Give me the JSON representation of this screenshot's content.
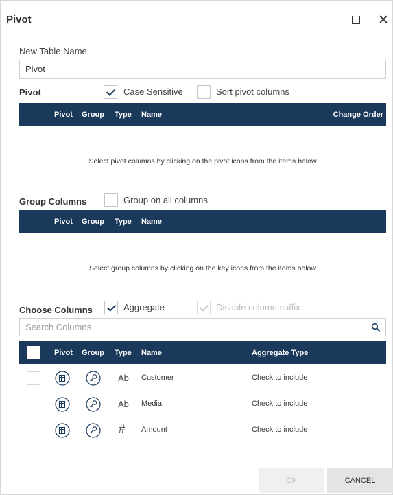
{
  "dialog": {
    "title": "Pivot",
    "maximize_icon": "maximize-icon",
    "close_icon": "close-icon",
    "close_glyph": "✕"
  },
  "table_name": {
    "label": "New Table Name",
    "value": "Pivot"
  },
  "pivot_section": {
    "label": "Pivot",
    "case_sensitive": {
      "label": "Case Sensitive",
      "checked": true
    },
    "sort_pivot": {
      "label": "Sort pivot columns",
      "checked": false
    },
    "headers": {
      "pivot": "Pivot",
      "group": "Group",
      "type": "Type",
      "name": "Name",
      "change_order": "Change Order"
    },
    "empty_message": "Select pivot columns by clicking on the pivot icons from the items below"
  },
  "group_section": {
    "label": "Group Columns",
    "group_all": {
      "label": "Group on all columns",
      "checked": false
    },
    "headers": {
      "pivot": "Pivot",
      "group": "Group",
      "type": "Type",
      "name": "Name"
    },
    "empty_message": "Select group columns by clicking on the key icons from the items below"
  },
  "choose_section": {
    "label": "Choose Columns",
    "aggregate": {
      "label": "Aggregate",
      "checked": true
    },
    "disable_suffix": {
      "label": "Disable column suffix",
      "checked": true,
      "disabled": true
    },
    "search_placeholder": "Search Columns",
    "headers": {
      "pivot": "Pivot",
      "group": "Group",
      "type": "Type",
      "name": "Name",
      "aggregate_type": "Aggregate Type"
    },
    "rows": [
      {
        "type": "Ab",
        "name": "Customer",
        "aggregate": "Check to include"
      },
      {
        "type": "Ab",
        "name": "Media",
        "aggregate": "Check to include"
      },
      {
        "type": "#",
        "name": "Amount",
        "aggregate": "Check to include"
      }
    ]
  },
  "footer": {
    "ok_label": "OK",
    "cancel_label": "CANCEL"
  },
  "colors": {
    "header_bg": "#1b3a5b",
    "check": "#1f3b5a"
  }
}
